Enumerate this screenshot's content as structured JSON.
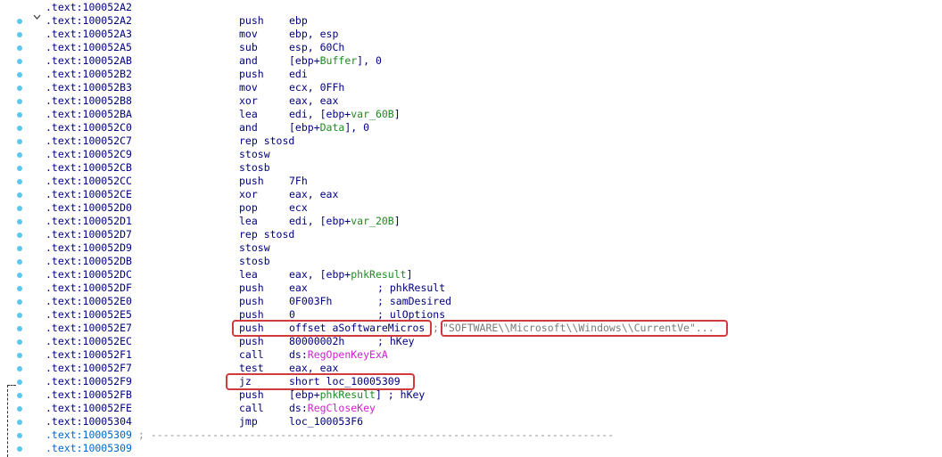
{
  "colors": {
    "background": "#ffffff",
    "code_text": "#000080",
    "label_address": "#0066cc",
    "variable_green": "#1f8a1f",
    "api_magenta": "#d020d0",
    "string_gray": "#7a7a7a",
    "highlight_red": "#d23b3b",
    "gutter_dot": "#5bc8f0"
  },
  "icons": {
    "collapse": "chevron-down-icon",
    "breakpoint": "dot-icon"
  },
  "lines": [
    {
      "addr": ".text:100052A2"
    },
    {
      "addr": ".text:100052A2",
      "mn": "push",
      "op": "ebp"
    },
    {
      "addr": ".text:100052A3",
      "mn": "mov",
      "op": "ebp, esp"
    },
    {
      "addr": ".text:100052A5",
      "mn": "sub",
      "op": "esp, 60Ch"
    },
    {
      "addr": ".text:100052AB",
      "mn": "and",
      "op_parts": [
        "[ebp+",
        "Buffer",
        "], 0"
      ]
    },
    {
      "addr": ".text:100052B2",
      "mn": "push",
      "op": "edi"
    },
    {
      "addr": ".text:100052B3",
      "mn": "mov",
      "op": "ecx, 0FFh"
    },
    {
      "addr": ".text:100052B8",
      "mn": "xor",
      "op": "eax, eax"
    },
    {
      "addr": ".text:100052BA",
      "mn": "lea",
      "op_parts": [
        "edi, [ebp+",
        "var_60B",
        "]"
      ]
    },
    {
      "addr": ".text:100052C0",
      "mn": "and",
      "op_parts": [
        "[ebp+",
        "Data",
        "], 0"
      ]
    },
    {
      "addr": ".text:100052C7",
      "mn": "rep stosd",
      "op": ""
    },
    {
      "addr": ".text:100052C9",
      "mn": "stosw",
      "op": ""
    },
    {
      "addr": ".text:100052CB",
      "mn": "stosb",
      "op": ""
    },
    {
      "addr": ".text:100052CC",
      "mn": "push",
      "op": "7Fh"
    },
    {
      "addr": ".text:100052CE",
      "mn": "xor",
      "op": "eax, eax"
    },
    {
      "addr": ".text:100052D0",
      "mn": "pop",
      "op": "ecx"
    },
    {
      "addr": ".text:100052D1",
      "mn": "lea",
      "op_parts": [
        "edi, [ebp+",
        "var_20B",
        "]"
      ]
    },
    {
      "addr": ".text:100052D7",
      "mn": "rep stosd",
      "op": ""
    },
    {
      "addr": ".text:100052D9",
      "mn": "stosw",
      "op": ""
    },
    {
      "addr": ".text:100052DB",
      "mn": "stosb",
      "op": ""
    },
    {
      "addr": ".text:100052DC",
      "mn": "lea",
      "op_parts": [
        "eax, [ebp+",
        "phkResult",
        "]"
      ]
    },
    {
      "addr": ".text:100052DF",
      "mn": "push",
      "op": "eax",
      "cm": "; phkResult"
    },
    {
      "addr": ".text:100052E0",
      "mn": "push",
      "op": "0F003Fh",
      "cm": "; samDesired"
    },
    {
      "addr": ".text:100052E5",
      "mn": "push",
      "op": "0",
      "cm": "; ulOptions"
    },
    {
      "addr": ".text:100052E7",
      "mn": "push",
      "op": "offset aSoftwareMicros",
      "semi": ";",
      "str": "\"SOFTWARE\\\\Microsoft\\\\Windows\\\\CurrentVe\"..."
    },
    {
      "addr": ".text:100052EC",
      "mn": "push",
      "op": "80000002h",
      "cm": "; hKey"
    },
    {
      "addr": ".text:100052F1",
      "mn": "call",
      "op_parts": [
        "ds:",
        "RegOpenKeyExA",
        ""
      ]
    },
    {
      "addr": ".text:100052F7",
      "mn": "test",
      "op": "eax, eax"
    },
    {
      "addr": ".text:100052F9",
      "mn": "jz",
      "op": "short loc_10005309"
    },
    {
      "addr": ".text:100052FB",
      "mn": "push",
      "op_parts": [
        "[ebp+",
        "phkResult",
        "]"
      ],
      "cm": "; hKey",
      "cm_inline": true
    },
    {
      "addr": ".text:100052FE",
      "mn": "call",
      "op_parts": [
        "ds:",
        "RegCloseKey",
        ""
      ]
    },
    {
      "addr": ".text:10005304",
      "mn": "jmp",
      "op": "loc_100053F6"
    },
    {
      "addr": ".text:10005309",
      "label": true,
      "sep": "; ---------------------------------------------------------------------------"
    },
    {
      "addr": ".text:10005309",
      "label": true
    }
  ]
}
